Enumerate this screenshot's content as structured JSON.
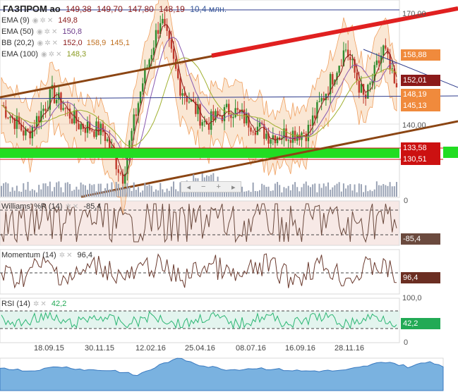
{
  "header": {
    "ticker": "ГАЗПРОМ ао",
    "open": "149,38",
    "high": "149,70",
    "low": "147,80",
    "close": "148,19",
    "volume": "10,4 млн."
  },
  "indicators": {
    "ema9": {
      "label": "EMA (9)",
      "value": "149,8"
    },
    "ema50": {
      "label": "EMA (50)",
      "value": "150,8"
    },
    "bb": {
      "label": "BB (20,2)",
      "v1": "152,0",
      "v2": "158,9",
      "v3": "145,1"
    },
    "ema100": {
      "label": "EMA (100)",
      "value": "148,3"
    }
  },
  "price_axis": {
    "t170": "170,00",
    "t140": "140,00",
    "b158": "158,88",
    "b152": "152,01",
    "b148": "148,19",
    "b145": "145,13",
    "b133": "133,58",
    "b130": "130,51"
  },
  "williams": {
    "label": "Williams' %R (14)",
    "value": "-85,4",
    "axis_top": "0",
    "badge": "-85,4"
  },
  "momentum": {
    "label": "Momentum (14)",
    "value": "96,4",
    "badge": "96,4"
  },
  "rsi": {
    "label": "RSI (14)",
    "value": "42,2",
    "axis_top": "100,0",
    "axis_bottom": "0",
    "badge": "42,2"
  },
  "dates": [
    "18.09.15",
    "30.11.15",
    "12.02.16",
    "25.04.16",
    "08.07.16",
    "16.09.16",
    "28.11.16"
  ],
  "nav": {
    "left": "◂",
    "minus": "−",
    "plus": "+",
    "right": "▸"
  },
  "colors": {
    "candle_up": "#2e8b2e",
    "candle_down": "#c0392b",
    "trend_channel": "#8b4513",
    "resistance": "#e02020",
    "support_zone": "#22dd22",
    "bb_fill": "#f5c9a0",
    "rsi_line": "#2bb673",
    "williams_line": "#6b4a3e",
    "momentum_line": "#6b3a2e",
    "badge_orange": "#f08a3c",
    "badge_darkred": "#8b1a1a",
    "badge_red": "#cc1111",
    "badge_green": "#22aa55",
    "badge_brown": "#6b2e22"
  }
}
